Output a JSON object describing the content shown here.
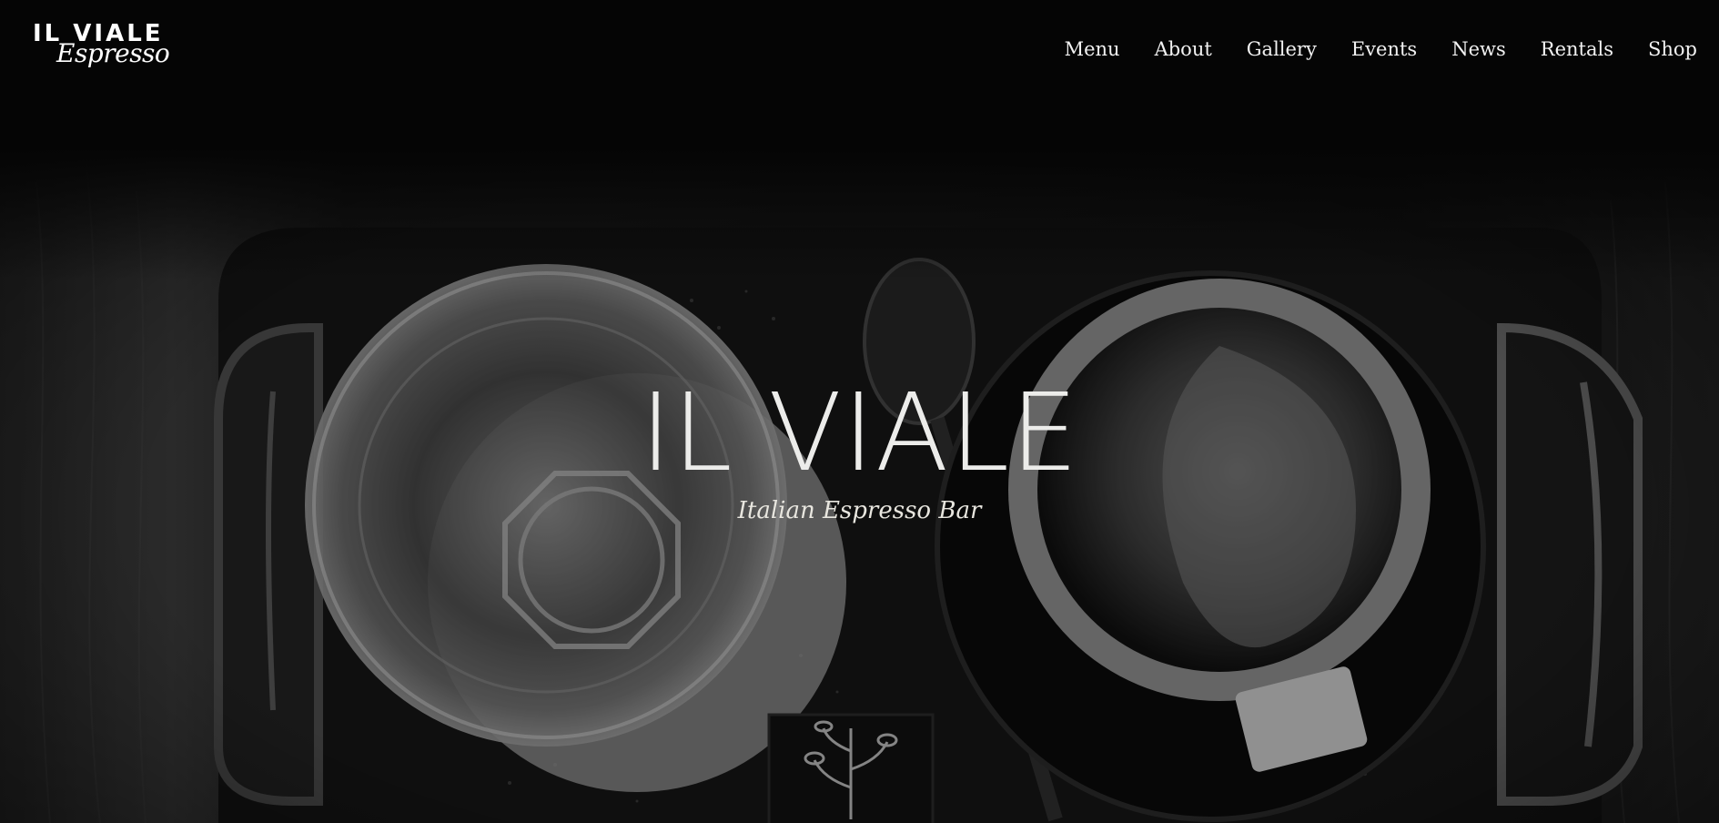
{
  "header": {
    "logo": {
      "main": "IL VIALE",
      "script": "Espresso"
    },
    "nav": [
      {
        "label": "Menu"
      },
      {
        "label": "About"
      },
      {
        "label": "Gallery"
      },
      {
        "label": "Events"
      },
      {
        "label": "News"
      },
      {
        "label": "Rentals"
      },
      {
        "label": "Shop"
      }
    ]
  },
  "hero": {
    "title": "IL VIALE",
    "subtitle": "Italian Espresso Bar",
    "image": "espresso-cup-and-water-glass-on-tray"
  },
  "colors": {
    "background": "#050505",
    "text": "#ececea",
    "nav_text": "#f2f2f2"
  }
}
